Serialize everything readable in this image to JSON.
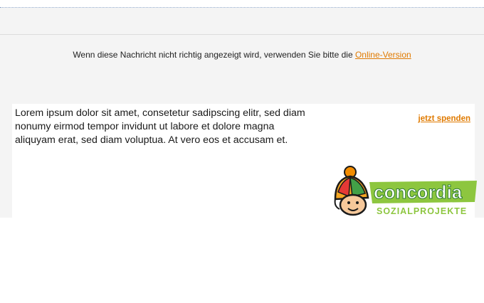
{
  "header": {
    "notice_text": "Wenn diese Nachricht nicht richtig angezeigt wird, verwenden Sie bitte die ",
    "online_version_link": "Online-Version"
  },
  "content": {
    "body_text": "Lorem ipsum dolor sit amet, consetetur sadipscing elitr, sed diam nonumy eirmod tempor invidunt ut labore et dolore magna aliquyam erat, sed diam voluptua. At vero eos et accusam et.",
    "donate_link": "jetzt spenden"
  },
  "logo": {
    "name": "concordia",
    "tagline": "SOZIALPROJEKTE",
    "icon": "hat-boy-mascot-icon"
  },
  "colors": {
    "link": "#e07a00",
    "brand_green": "#8dc63f",
    "background": "#f4f4f4"
  }
}
